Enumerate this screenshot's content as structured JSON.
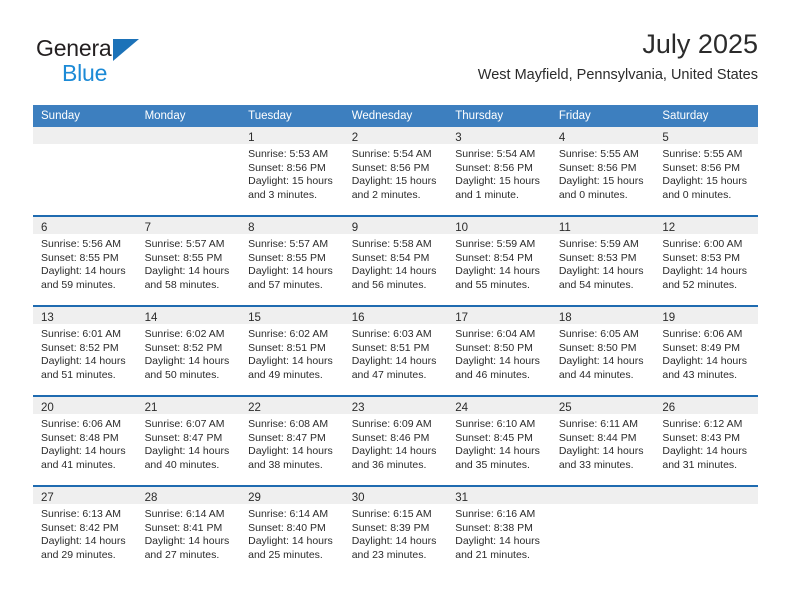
{
  "brand": {
    "name_part1": "General",
    "name_part2": "Blue",
    "triangle_color": "#1c72b8",
    "blue_color": "#1c8ad6"
  },
  "header": {
    "title": "July 2025",
    "subtitle": "West Mayfield, Pennsylvania, United States"
  },
  "theme": {
    "header_blue": "#3d7fbf",
    "row_divider_blue": "#1f6bb0",
    "daynum_band": "#efefef"
  },
  "weekday_headers": [
    "Sunday",
    "Monday",
    "Tuesday",
    "Wednesday",
    "Thursday",
    "Friday",
    "Saturday"
  ],
  "weeks": [
    [
      {
        "day": "",
        "sunrise": "",
        "sunset": "",
        "daylight1": "",
        "daylight2": ""
      },
      {
        "day": "",
        "sunrise": "",
        "sunset": "",
        "daylight1": "",
        "daylight2": ""
      },
      {
        "day": "1",
        "sunrise": "Sunrise: 5:53 AM",
        "sunset": "Sunset: 8:56 PM",
        "daylight1": "Daylight: 15 hours",
        "daylight2": "and 3 minutes."
      },
      {
        "day": "2",
        "sunrise": "Sunrise: 5:54 AM",
        "sunset": "Sunset: 8:56 PM",
        "daylight1": "Daylight: 15 hours",
        "daylight2": "and 2 minutes."
      },
      {
        "day": "3",
        "sunrise": "Sunrise: 5:54 AM",
        "sunset": "Sunset: 8:56 PM",
        "daylight1": "Daylight: 15 hours",
        "daylight2": "and 1 minute."
      },
      {
        "day": "4",
        "sunrise": "Sunrise: 5:55 AM",
        "sunset": "Sunset: 8:56 PM",
        "daylight1": "Daylight: 15 hours",
        "daylight2": "and 0 minutes."
      },
      {
        "day": "5",
        "sunrise": "Sunrise: 5:55 AM",
        "sunset": "Sunset: 8:56 PM",
        "daylight1": "Daylight: 15 hours",
        "daylight2": "and 0 minutes."
      }
    ],
    [
      {
        "day": "6",
        "sunrise": "Sunrise: 5:56 AM",
        "sunset": "Sunset: 8:55 PM",
        "daylight1": "Daylight: 14 hours",
        "daylight2": "and 59 minutes."
      },
      {
        "day": "7",
        "sunrise": "Sunrise: 5:57 AM",
        "sunset": "Sunset: 8:55 PM",
        "daylight1": "Daylight: 14 hours",
        "daylight2": "and 58 minutes."
      },
      {
        "day": "8",
        "sunrise": "Sunrise: 5:57 AM",
        "sunset": "Sunset: 8:55 PM",
        "daylight1": "Daylight: 14 hours",
        "daylight2": "and 57 minutes."
      },
      {
        "day": "9",
        "sunrise": "Sunrise: 5:58 AM",
        "sunset": "Sunset: 8:54 PM",
        "daylight1": "Daylight: 14 hours",
        "daylight2": "and 56 minutes."
      },
      {
        "day": "10",
        "sunrise": "Sunrise: 5:59 AM",
        "sunset": "Sunset: 8:54 PM",
        "daylight1": "Daylight: 14 hours",
        "daylight2": "and 55 minutes."
      },
      {
        "day": "11",
        "sunrise": "Sunrise: 5:59 AM",
        "sunset": "Sunset: 8:53 PM",
        "daylight1": "Daylight: 14 hours",
        "daylight2": "and 54 minutes."
      },
      {
        "day": "12",
        "sunrise": "Sunrise: 6:00 AM",
        "sunset": "Sunset: 8:53 PM",
        "daylight1": "Daylight: 14 hours",
        "daylight2": "and 52 minutes."
      }
    ],
    [
      {
        "day": "13",
        "sunrise": "Sunrise: 6:01 AM",
        "sunset": "Sunset: 8:52 PM",
        "daylight1": "Daylight: 14 hours",
        "daylight2": "and 51 minutes."
      },
      {
        "day": "14",
        "sunrise": "Sunrise: 6:02 AM",
        "sunset": "Sunset: 8:52 PM",
        "daylight1": "Daylight: 14 hours",
        "daylight2": "and 50 minutes."
      },
      {
        "day": "15",
        "sunrise": "Sunrise: 6:02 AM",
        "sunset": "Sunset: 8:51 PM",
        "daylight1": "Daylight: 14 hours",
        "daylight2": "and 49 minutes."
      },
      {
        "day": "16",
        "sunrise": "Sunrise: 6:03 AM",
        "sunset": "Sunset: 8:51 PM",
        "daylight1": "Daylight: 14 hours",
        "daylight2": "and 47 minutes."
      },
      {
        "day": "17",
        "sunrise": "Sunrise: 6:04 AM",
        "sunset": "Sunset: 8:50 PM",
        "daylight1": "Daylight: 14 hours",
        "daylight2": "and 46 minutes."
      },
      {
        "day": "18",
        "sunrise": "Sunrise: 6:05 AM",
        "sunset": "Sunset: 8:50 PM",
        "daylight1": "Daylight: 14 hours",
        "daylight2": "and 44 minutes."
      },
      {
        "day": "19",
        "sunrise": "Sunrise: 6:06 AM",
        "sunset": "Sunset: 8:49 PM",
        "daylight1": "Daylight: 14 hours",
        "daylight2": "and 43 minutes."
      }
    ],
    [
      {
        "day": "20",
        "sunrise": "Sunrise: 6:06 AM",
        "sunset": "Sunset: 8:48 PM",
        "daylight1": "Daylight: 14 hours",
        "daylight2": "and 41 minutes."
      },
      {
        "day": "21",
        "sunrise": "Sunrise: 6:07 AM",
        "sunset": "Sunset: 8:47 PM",
        "daylight1": "Daylight: 14 hours",
        "daylight2": "and 40 minutes."
      },
      {
        "day": "22",
        "sunrise": "Sunrise: 6:08 AM",
        "sunset": "Sunset: 8:47 PM",
        "daylight1": "Daylight: 14 hours",
        "daylight2": "and 38 minutes."
      },
      {
        "day": "23",
        "sunrise": "Sunrise: 6:09 AM",
        "sunset": "Sunset: 8:46 PM",
        "daylight1": "Daylight: 14 hours",
        "daylight2": "and 36 minutes."
      },
      {
        "day": "24",
        "sunrise": "Sunrise: 6:10 AM",
        "sunset": "Sunset: 8:45 PM",
        "daylight1": "Daylight: 14 hours",
        "daylight2": "and 35 minutes."
      },
      {
        "day": "25",
        "sunrise": "Sunrise: 6:11 AM",
        "sunset": "Sunset: 8:44 PM",
        "daylight1": "Daylight: 14 hours",
        "daylight2": "and 33 minutes."
      },
      {
        "day": "26",
        "sunrise": "Sunrise: 6:12 AM",
        "sunset": "Sunset: 8:43 PM",
        "daylight1": "Daylight: 14 hours",
        "daylight2": "and 31 minutes."
      }
    ],
    [
      {
        "day": "27",
        "sunrise": "Sunrise: 6:13 AM",
        "sunset": "Sunset: 8:42 PM",
        "daylight1": "Daylight: 14 hours",
        "daylight2": "and 29 minutes."
      },
      {
        "day": "28",
        "sunrise": "Sunrise: 6:14 AM",
        "sunset": "Sunset: 8:41 PM",
        "daylight1": "Daylight: 14 hours",
        "daylight2": "and 27 minutes."
      },
      {
        "day": "29",
        "sunrise": "Sunrise: 6:14 AM",
        "sunset": "Sunset: 8:40 PM",
        "daylight1": "Daylight: 14 hours",
        "daylight2": "and 25 minutes."
      },
      {
        "day": "30",
        "sunrise": "Sunrise: 6:15 AM",
        "sunset": "Sunset: 8:39 PM",
        "daylight1": "Daylight: 14 hours",
        "daylight2": "and 23 minutes."
      },
      {
        "day": "31",
        "sunrise": "Sunrise: 6:16 AM",
        "sunset": "Sunset: 8:38 PM",
        "daylight1": "Daylight: 14 hours",
        "daylight2": "and 21 minutes."
      },
      {
        "day": "",
        "sunrise": "",
        "sunset": "",
        "daylight1": "",
        "daylight2": ""
      },
      {
        "day": "",
        "sunrise": "",
        "sunset": "",
        "daylight1": "",
        "daylight2": ""
      }
    ]
  ]
}
